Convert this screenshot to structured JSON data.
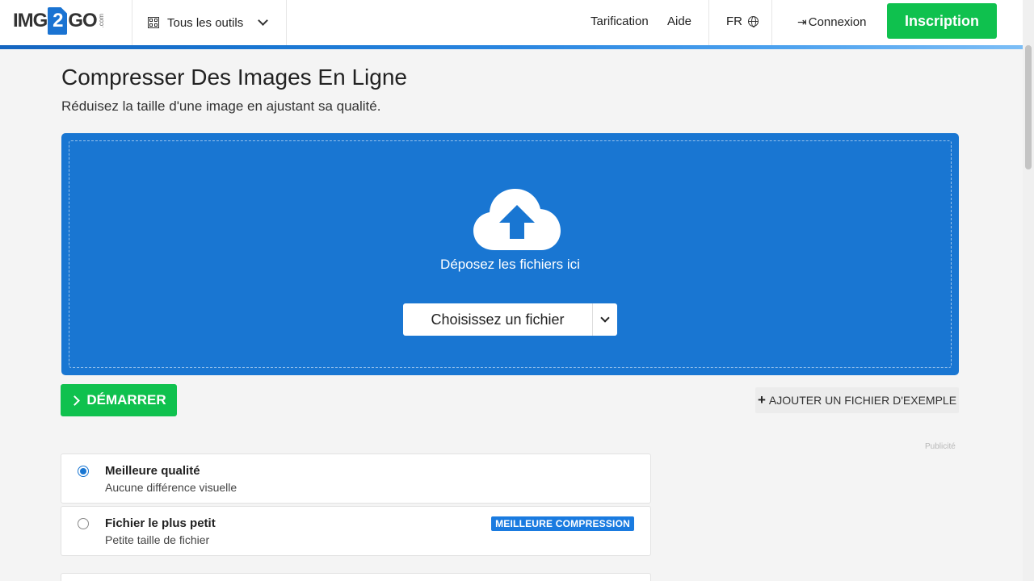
{
  "header": {
    "logo": {
      "prefix": "IMG",
      "two": "2",
      "suffix": "GO",
      "tld": ".com"
    },
    "tools_label": "Tous les outils",
    "nav": {
      "pricing": "Tarification",
      "help": "Aide",
      "lang": "FR"
    },
    "login": "Connexion",
    "signup": "Inscription"
  },
  "page": {
    "title": "Compresser Des Images En Ligne",
    "subtitle": "Réduisez la taille d'une image en ajustant sa qualité."
  },
  "dropzone": {
    "drop_text": "Déposez les fichiers ici",
    "choose_label": "Choisissez un fichier"
  },
  "actions": {
    "start": "DÉMARRER",
    "sample": "AJOUTER UN FICHIER D'EXEMPLE",
    "ad_label": "Publicité"
  },
  "options": [
    {
      "title": "Meilleure qualité",
      "desc": "Aucune différence visuelle",
      "selected": true
    },
    {
      "title": "Fichier le plus petit",
      "desc": "Petite taille de fichier",
      "badge": "MEILLEURE COMPRESSION",
      "selected": false
    }
  ],
  "colors": {
    "brand_blue": "#1976d2",
    "green": "#0fc14e"
  }
}
